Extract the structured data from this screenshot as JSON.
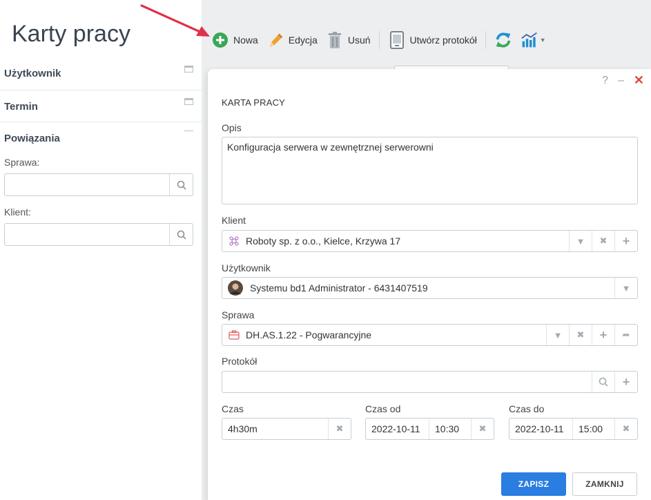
{
  "page": {
    "title": "Karty pracy"
  },
  "sidebar": {
    "sections": [
      {
        "label": "Użytkownik",
        "state": "collapsed"
      },
      {
        "label": "Termin",
        "state": "collapsed"
      },
      {
        "label": "Powiązania",
        "state": "expanded"
      }
    ],
    "fields": [
      {
        "label": "Sprawa:",
        "value": ""
      },
      {
        "label": "Klient:",
        "value": ""
      }
    ]
  },
  "toolbar": {
    "new_label": "Nowa",
    "edit_label": "Edycja",
    "delete_label": "Usuń",
    "protocol_label": "Utwórz protokół"
  },
  "dialog": {
    "help": "?",
    "minimize": "–",
    "close": "✕",
    "title": "KARTA PRACY",
    "opis_label": "Opis",
    "opis_value": "Konfiguracja serwera w zewnętrznej serwerowni",
    "klient_label": "Klient",
    "klient_value": "Roboty sp. z o.o., Kielce, Krzywa 17",
    "uzytkownik_label": "Użytkownik",
    "uzytkownik_value": "Systemu bd1 Administrator - 6431407519",
    "sprawa_label": "Sprawa",
    "sprawa_value": "DH.AS.1.22 - Pogwarancyjne",
    "protokol_label": "Protokół",
    "protokol_value": "",
    "czas_label": "Czas",
    "czas_value": "4h30m",
    "czas_od_label": "Czas od",
    "czas_od_date": "2022-10-11",
    "czas_od_time": "10:30",
    "czas_do_label": "Czas do",
    "czas_do_date": "2022-10-11",
    "czas_do_time": "15:00",
    "save_label": "ZAPISZ",
    "close_label": "ZAMKNIJ"
  },
  "colors": {
    "primary": "#2a7de1",
    "close_red": "#e0463a",
    "new_green": "#3aa757",
    "arrow_red": "#e0314b",
    "edit_orange": "#f0a030"
  },
  "icons": [
    "plus-circle-icon",
    "pencil-icon",
    "trash-icon",
    "document-icon",
    "refresh-icon",
    "chart-icon",
    "search-icon",
    "chevron-down-icon",
    "clear-icon",
    "plus-icon",
    "arrow-right-icon",
    "client-icon",
    "avatar",
    "briefcase-icon"
  ]
}
